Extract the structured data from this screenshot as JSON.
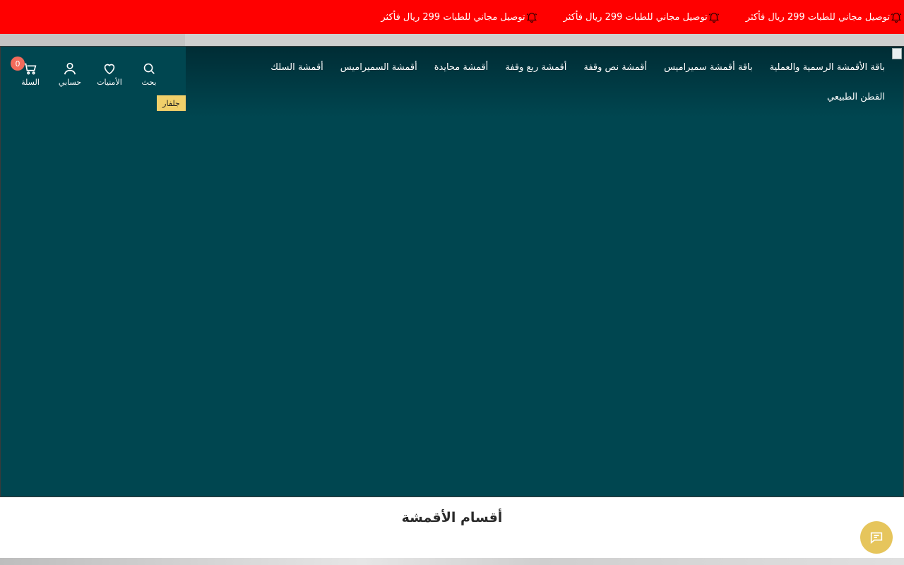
{
  "announcement": {
    "items": [
      {
        "text": "توصيل مجاني للطبات 299 ريال فأكثر",
        "icon": "bell-icon"
      },
      {
        "text": "توصيل مجاني للطبات 299 ريال فأكثر",
        "icon": "bell-icon"
      },
      {
        "text": "توصيل مجاني للطبات 299 ريال فأكثر",
        "icon": "bell-icon"
      }
    ],
    "partial_text": "299 ريال فأكثر",
    "background": "#ff0000"
  },
  "header": {
    "nav": [
      {
        "label": "باقة الأقمشة الرسمية والعملية"
      },
      {
        "label": "باقة أقمشة سميراميس"
      },
      {
        "label": "أقمشة نص وقفة"
      },
      {
        "label": "أقمشة ربع وقفة"
      },
      {
        "label": "أقمشة محايدة"
      },
      {
        "label": "أقمشة السميراميس"
      },
      {
        "label": "أقمشة السلك"
      },
      {
        "label": "القطن الطبيعي"
      }
    ],
    "icons": {
      "search_label": "بحث",
      "wishlist_label": "الأمنيات",
      "account_label": "حسابي",
      "cart_label": "السلة",
      "cart_count": "0"
    },
    "logo_text": "جلفار"
  },
  "hero": {
    "background": "#004650"
  },
  "sections": {
    "categories_title": "أقسام الأقمشة"
  },
  "colors": {
    "accent": "#e6c55c",
    "badge": "#f26b5b"
  }
}
